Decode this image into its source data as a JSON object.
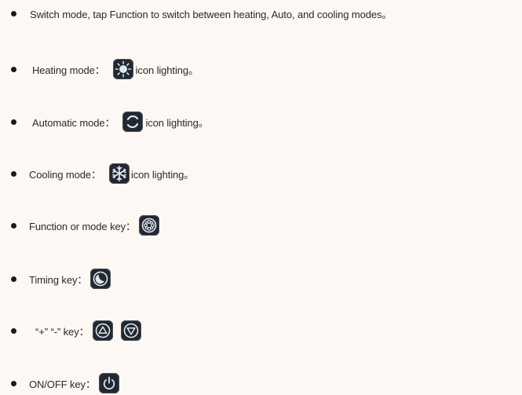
{
  "items": [
    {
      "text": "Switch mode, tap Function to switch between heating, Auto, and cooling modes。"
    },
    {
      "before": "Heating mode：",
      "icon": "sun-icon",
      "after": "icon lighting。"
    },
    {
      "before": "Automatic mode：",
      "icon": "auto-cycle-icon",
      "after": "icon lighting。"
    },
    {
      "before": "Cooling mode：",
      "icon": "snowflake-icon",
      "after": "icon lighting。"
    },
    {
      "before": "Function or mode key：",
      "icon": "function-key-icon"
    },
    {
      "before": "Timing key：",
      "icon": "timer-key-icon"
    },
    {
      "before": "“+” “-” key：",
      "icons": [
        "up-triangle-icon",
        "down-triangle-icon"
      ]
    },
    {
      "before": "ON/OFF key：",
      "icon": "power-icon"
    }
  ],
  "colors": {
    "background": "#fdf8f4",
    "text": "#2a2a2a",
    "key": "#222831",
    "icon": "#dfe7ef"
  }
}
